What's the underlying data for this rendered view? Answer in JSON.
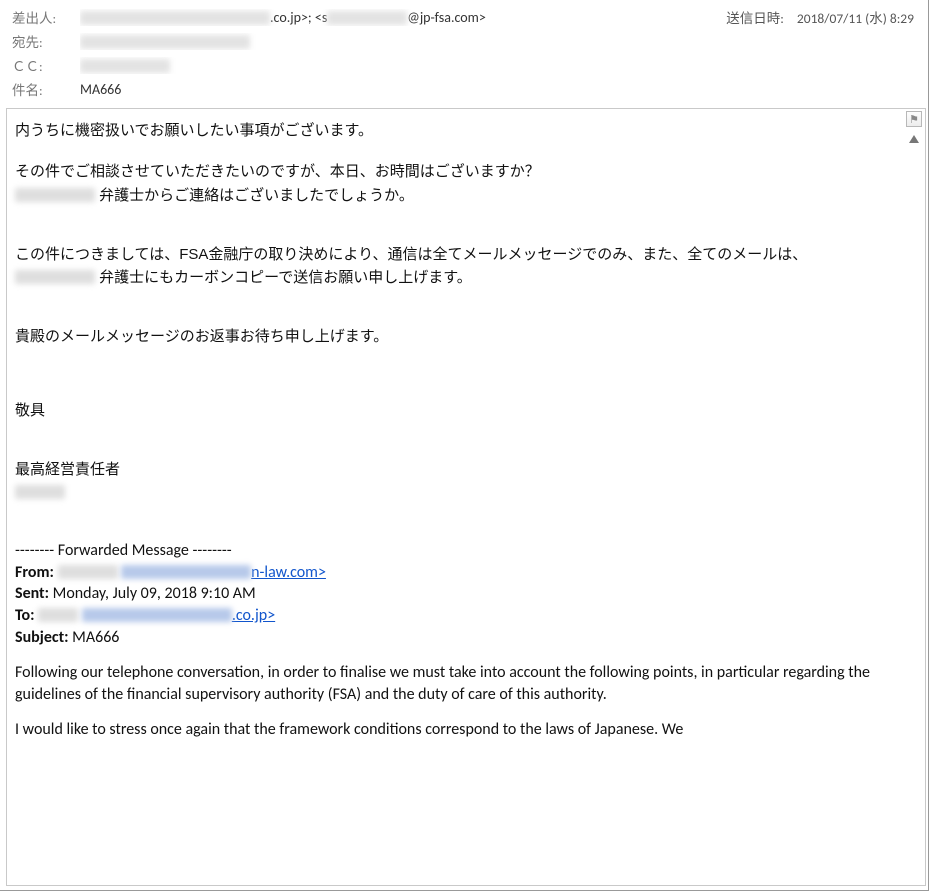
{
  "header": {
    "labels": {
      "from": "差出人:",
      "to": "宛先:",
      "cc": "ＣＣ:",
      "subject": "件名:",
      "sent": "送信日時:"
    },
    "from_suffix1": ".co.jp>; <s",
    "from_suffix2": "@jp-fsa.com>",
    "subject_value": "MA666",
    "sent_value": "2018/07/11 (水) 8:29"
  },
  "body": {
    "p1": "内うちに機密扱いでお願いしたい事項がございます。",
    "p2": "その件でご相談させていただきたいのですが、本日、お時間はございますか？",
    "p3_suffix": " 弁護士からご連絡はございましたでしょうか。",
    "p4": "この件につきましては、FSA金融庁の取り決めにより、通信は全てメールメッセージでのみ、また、全てのメールは、",
    "p5_suffix": " 弁護士にもカーボンコピーで送信お願い申し上げます。",
    "p6": "貴殿のメールメッセージのお返事お待ち申し上げます。",
    "p7": "敬具",
    "p8": "最高経営責任者"
  },
  "forwarded": {
    "divider": "-------- Forwarded Message --------",
    "from_label": "From:",
    "from_suffix": "n-law.com>",
    "sent_label": "Sent:",
    "sent_value": " Monday, July 09, 2018 9:10 AM",
    "to_label": "To:",
    "to_suffix": ".co.jp>",
    "subject_label": "Subject:",
    "subject_value": " MA666",
    "body_p1": "Following our telephone conversation, in order to finalise we must take into account the following points, in particular regarding the guidelines of the financial supervisory authority (FSA) and the duty of care of this authority.",
    "body_p2": "I would like to stress once again that the framework conditions correspond to the laws of Japanese. We"
  }
}
